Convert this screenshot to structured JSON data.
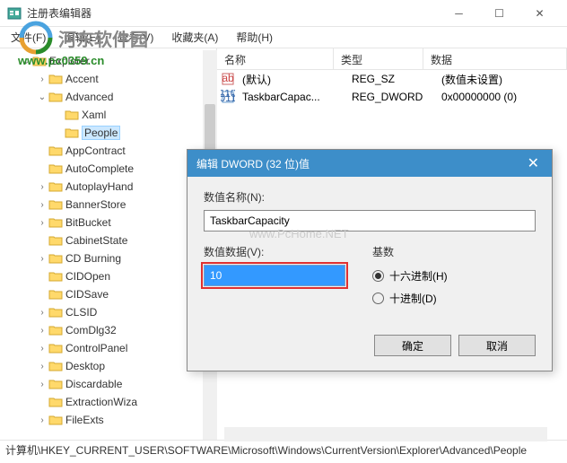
{
  "titlebar": {
    "title": "注册表编辑器"
  },
  "menubar": {
    "file": "文件(F)",
    "edit": "编辑(E)",
    "view": "查看(V)",
    "favorites": "收藏夹(A)",
    "help": "帮助(H)"
  },
  "watermark": {
    "brand": "河东软件园",
    "url": "www.pc0359.cn",
    "center": "www.PcHome.NET"
  },
  "tree": {
    "items": [
      {
        "label": "Explorer",
        "indent": 1,
        "toggle": "v"
      },
      {
        "label": "Accent",
        "indent": 2,
        "toggle": ">"
      },
      {
        "label": "Advanced",
        "indent": 2,
        "toggle": "v"
      },
      {
        "label": "Xaml",
        "indent": 3,
        "toggle": ""
      },
      {
        "label": "People",
        "indent": 3,
        "toggle": "",
        "selected": true
      },
      {
        "label": "AppContract",
        "indent": 2,
        "toggle": ""
      },
      {
        "label": "AutoComplete",
        "indent": 2,
        "toggle": ""
      },
      {
        "label": "AutoplayHand",
        "indent": 2,
        "toggle": ">"
      },
      {
        "label": "BannerStore",
        "indent": 2,
        "toggle": ">"
      },
      {
        "label": "BitBucket",
        "indent": 2,
        "toggle": ">"
      },
      {
        "label": "CabinetState",
        "indent": 2,
        "toggle": ""
      },
      {
        "label": "CD Burning",
        "indent": 2,
        "toggle": ">"
      },
      {
        "label": "CIDOpen",
        "indent": 2,
        "toggle": ""
      },
      {
        "label": "CIDSave",
        "indent": 2,
        "toggle": ""
      },
      {
        "label": "CLSID",
        "indent": 2,
        "toggle": ">"
      },
      {
        "label": "ComDlg32",
        "indent": 2,
        "toggle": ">"
      },
      {
        "label": "ControlPanel",
        "indent": 2,
        "toggle": ">"
      },
      {
        "label": "Desktop",
        "indent": 2,
        "toggle": ">"
      },
      {
        "label": "Discardable",
        "indent": 2,
        "toggle": ">"
      },
      {
        "label": "ExtractionWiza",
        "indent": 2,
        "toggle": ""
      },
      {
        "label": "FileExts",
        "indent": 2,
        "toggle": ">"
      }
    ]
  },
  "list": {
    "headers": {
      "name": "名称",
      "type": "类型",
      "data": "数据"
    },
    "rows": [
      {
        "name": "(默认)",
        "type": "REG_SZ",
        "data": "(数值未设置)",
        "icon": "string"
      },
      {
        "name": "TaskbarCapac...",
        "type": "REG_DWORD",
        "data": "0x00000000 (0)",
        "icon": "binary"
      }
    ]
  },
  "dialog": {
    "title": "编辑 DWORD (32 位)值",
    "name_label": "数值名称(N):",
    "name_value": "TaskbarCapacity",
    "value_label": "数值数据(V):",
    "value_value": "10",
    "base_label": "基数",
    "radio_hex": "十六进制(H)",
    "radio_dec": "十进制(D)",
    "ok": "确定",
    "cancel": "取消"
  },
  "statusbar": {
    "path": "计算机\\HKEY_CURRENT_USER\\SOFTWARE\\Microsoft\\Windows\\CurrentVersion\\Explorer\\Advanced\\People"
  }
}
